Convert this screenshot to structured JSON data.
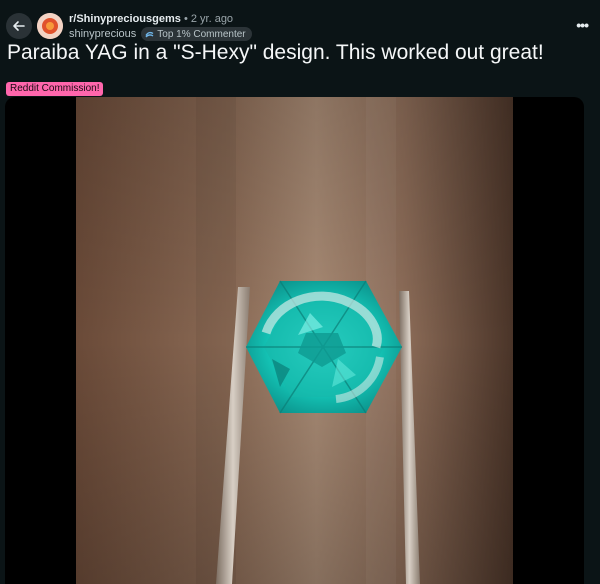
{
  "post": {
    "subreddit": "r/Shinypreciousgems",
    "separator": "•",
    "age": "2 yr. ago",
    "username": "shinyprecious",
    "flair_label": "Top 1% Commenter",
    "title": "Paraiba YAG in a \"S-Hexy\" design. This worked out great!",
    "tag": "Reddit Commission!"
  },
  "icons": {
    "back": "back-arrow-icon",
    "more": "more-options-icon",
    "flair": "top-commenter-icon"
  },
  "colors": {
    "background": "#0b1416",
    "tag": "#ff66ac",
    "gem": "#1fd6c8"
  }
}
